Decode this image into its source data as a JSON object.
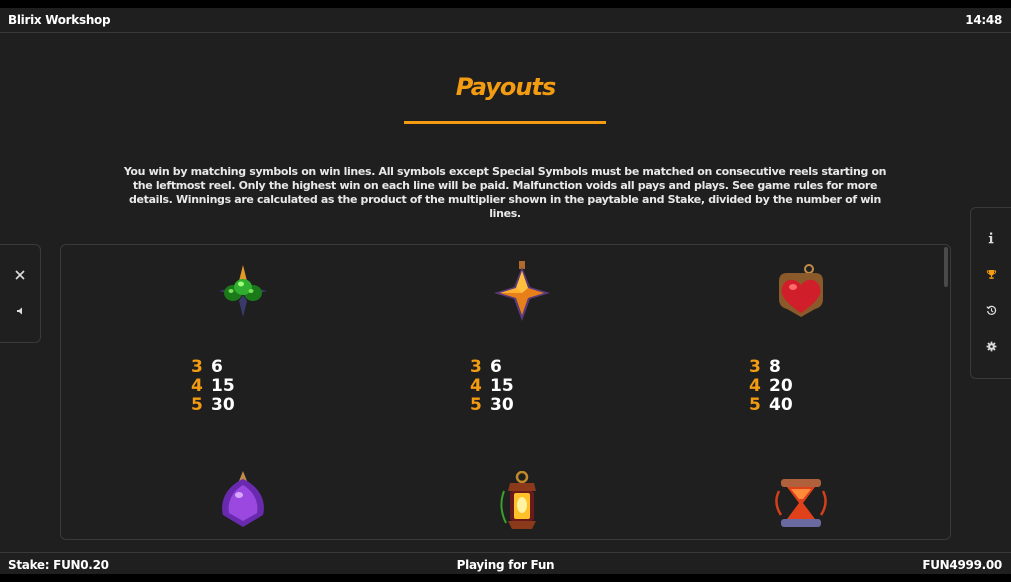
{
  "header": {
    "app_title": "Blirix Workshop",
    "clock": "14:48"
  },
  "title": "Payouts",
  "intro": "You win by matching symbols on win lines. All symbols except Special Symbols must be matched on consecutive reels starting on the leftmost reel. Only the highest win on each line will be paid. Malfunction voids all pays and plays. See game rules for more details. Winnings are calculated as the product of the multiplier shown in the paytable and Stake, divided by the number of win lines.",
  "left_controls": [
    {
      "name": "close-icon"
    },
    {
      "name": "sound-icon"
    }
  ],
  "right_controls": [
    {
      "name": "info-icon"
    },
    {
      "name": "trophy-icon"
    },
    {
      "name": "history-icon"
    },
    {
      "name": "settings-icon"
    }
  ],
  "symbols": [
    {
      "icon": "green-gem-symbol",
      "pays": [
        {
          "count": "3",
          "value": "6"
        },
        {
          "count": "4",
          "value": "15"
        },
        {
          "count": "5",
          "value": "30"
        }
      ]
    },
    {
      "icon": "orange-star-gem-symbol",
      "pays": [
        {
          "count": "3",
          "value": "6"
        },
        {
          "count": "4",
          "value": "15"
        },
        {
          "count": "5",
          "value": "30"
        }
      ]
    },
    {
      "icon": "red-heart-potion-symbol",
      "pays": [
        {
          "count": "3",
          "value": "8"
        },
        {
          "count": "4",
          "value": "20"
        },
        {
          "count": "5",
          "value": "40"
        }
      ]
    },
    {
      "icon": "purple-crystal-symbol"
    },
    {
      "icon": "lantern-symbol"
    },
    {
      "icon": "hourglass-symbol"
    }
  ],
  "footer": {
    "stake_label": "Stake:",
    "stake_value": "FUN0.20",
    "mode": "Playing for Fun",
    "balance": "FUN4999.00"
  },
  "colors": {
    "accent": "#f39c12",
    "background": "#1f1f1f",
    "border": "#3a3a3a"
  }
}
